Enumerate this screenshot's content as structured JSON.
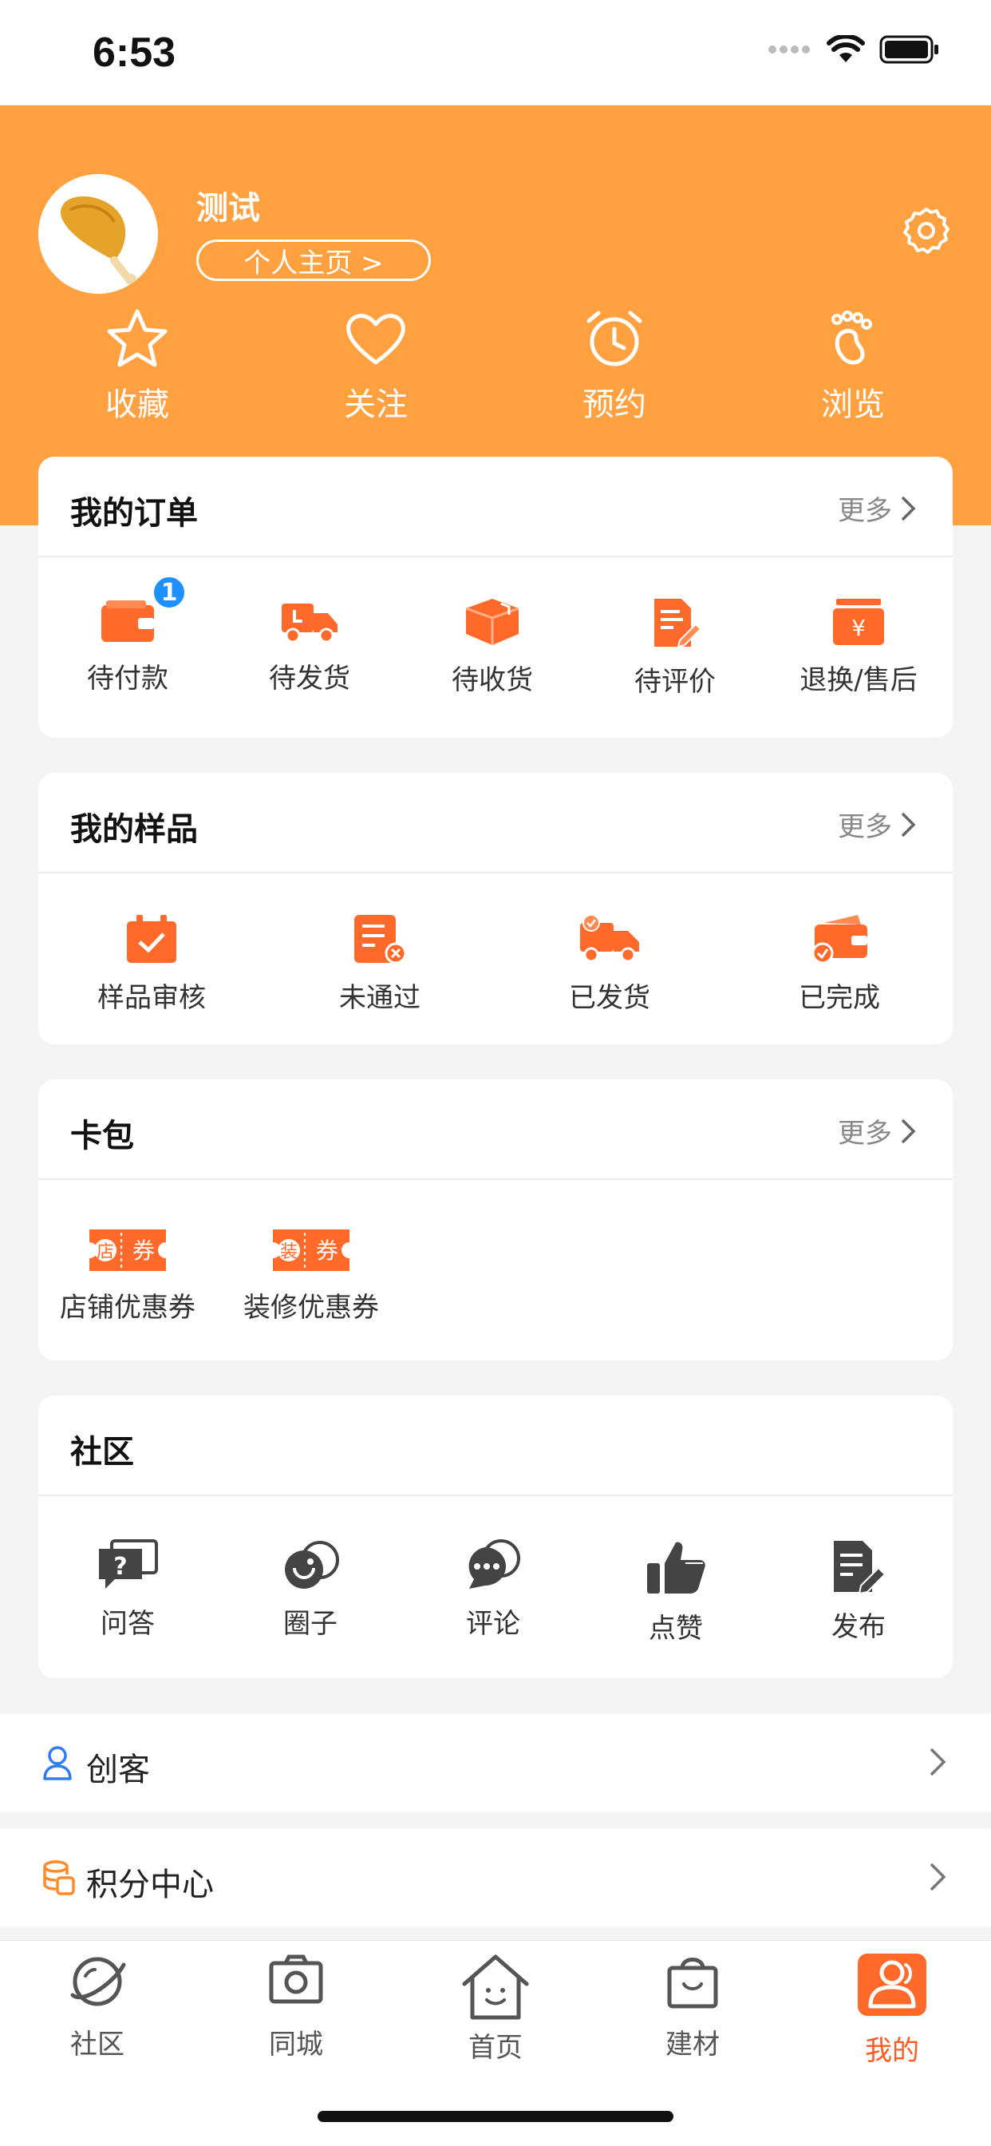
{
  "status": {
    "time": "6:53"
  },
  "profile": {
    "username": "测试",
    "homepage_label": "个人主页 >"
  },
  "quick_links": [
    {
      "label": "收藏",
      "icon": "star-icon"
    },
    {
      "label": "关注",
      "icon": "heart-icon"
    },
    {
      "label": "预约",
      "icon": "alarm-clock-icon"
    },
    {
      "label": "浏览",
      "icon": "footprint-icon"
    }
  ],
  "orders": {
    "title": "我的订单",
    "more": "更多",
    "items": [
      {
        "label": "待付款",
        "icon": "wallet-icon",
        "badge": "1"
      },
      {
        "label": "待发货",
        "icon": "truck-icon"
      },
      {
        "label": "待收货",
        "icon": "package-icon"
      },
      {
        "label": "待评价",
        "icon": "review-edit-icon"
      },
      {
        "label": "退换/售后",
        "icon": "refund-icon"
      }
    ]
  },
  "samples": {
    "title": "我的样品",
    "more": "更多",
    "items": [
      {
        "label": "样品审核",
        "icon": "calendar-check-icon"
      },
      {
        "label": "未通过",
        "icon": "rejected-document-icon"
      },
      {
        "label": "已发货",
        "icon": "shipped-truck-icon"
      },
      {
        "label": "已完成",
        "icon": "completed-wallet-icon"
      }
    ]
  },
  "wallet": {
    "title": "卡包",
    "more": "更多",
    "items": [
      {
        "label": "店铺优惠券",
        "icon": "store-coupon-icon",
        "tag": "店",
        "coupon": "券"
      },
      {
        "label": "装修优惠券",
        "icon": "decoration-coupon-icon",
        "tag": "装",
        "coupon": "券"
      }
    ]
  },
  "community": {
    "title": "社区",
    "items": [
      {
        "label": "问答",
        "icon": "question-chat-icon"
      },
      {
        "label": "圈子",
        "icon": "circle-chat-icon"
      },
      {
        "label": "评论",
        "icon": "comment-icon"
      },
      {
        "label": "点赞",
        "icon": "thumbs-up-icon"
      },
      {
        "label": "发布",
        "icon": "publish-icon"
      }
    ]
  },
  "menu": [
    {
      "label": "创客",
      "icon": "user-outline-icon"
    },
    {
      "label": "积分中心",
      "icon": "coins-icon"
    }
  ],
  "tabbar": [
    {
      "label": "社区",
      "icon": "planet-icon",
      "active": false
    },
    {
      "label": "同城",
      "icon": "camera-icon",
      "active": false
    },
    {
      "label": "首页",
      "icon": "house-icon",
      "active": false
    },
    {
      "label": "建材",
      "icon": "shopping-bag-icon",
      "active": false
    },
    {
      "label": "我的",
      "icon": "profile-icon",
      "active": true
    }
  ],
  "colors": {
    "header": "#ffa141",
    "accent": "#ff5a1f",
    "badge": "#1e90ff"
  }
}
